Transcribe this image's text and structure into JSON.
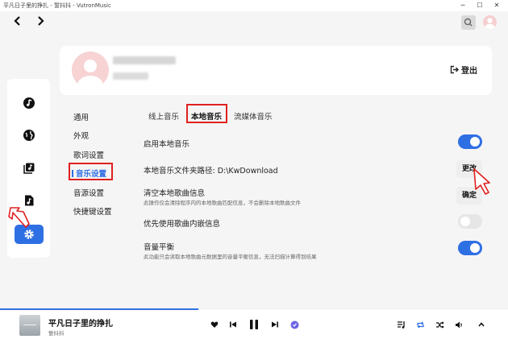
{
  "window": {
    "title": "平凡日子里的挣扎 - 誓抖抖 - VutronMusic",
    "controls": [
      "minimize-icon",
      "maximize-icon",
      "close-icon"
    ]
  },
  "nav": {
    "back_icon": "chevron-left-icon",
    "forward_icon": "chevron-right-icon",
    "search_icon": "search-icon"
  },
  "profile": {
    "logout_label": "登出"
  },
  "sidebar": {
    "items": [
      {
        "icon": "music-note-icon"
      },
      {
        "icon": "globe-icon"
      },
      {
        "icon": "library-icon"
      },
      {
        "icon": "local-music-icon"
      },
      {
        "icon": "gear-icon",
        "active": true
      }
    ]
  },
  "settings_nav": {
    "items": [
      {
        "label": "通用"
      },
      {
        "label": "外观"
      },
      {
        "label": "歌词设置"
      },
      {
        "label": "音乐设置",
        "active": true
      },
      {
        "label": "音源设置"
      },
      {
        "label": "快捷键设置"
      }
    ]
  },
  "subtabs": {
    "items": [
      {
        "label": "线上音乐"
      },
      {
        "label": "本地音乐",
        "active": true
      },
      {
        "label": "流媒体音乐"
      }
    ]
  },
  "settings": {
    "enable_local": {
      "title": "启用本地音乐",
      "on": true
    },
    "folder": {
      "title": "本地音乐文件夹路径: D:\\KwDownload",
      "button": "更改"
    },
    "clear": {
      "title": "清空本地歌曲信息",
      "desc": "此操作仅会清除程序内的本地歌曲匹配信息，不会删除本地歌曲文件",
      "button": "确定"
    },
    "embedded": {
      "title": "优先使用歌曲内嵌信息",
      "on": false
    },
    "volume": {
      "title": "音量平衡",
      "desc": "此功能只会读取本地歌曲元数据里的音量平衡信息，无法扫描计算得到结果",
      "on": true
    }
  },
  "player": {
    "song_title": "平凡日子里的挣扎",
    "artist": "誓抖抖",
    "progress": 0.39
  },
  "colors": {
    "accent": "#2f6fe4",
    "highlight": "#e02020"
  }
}
